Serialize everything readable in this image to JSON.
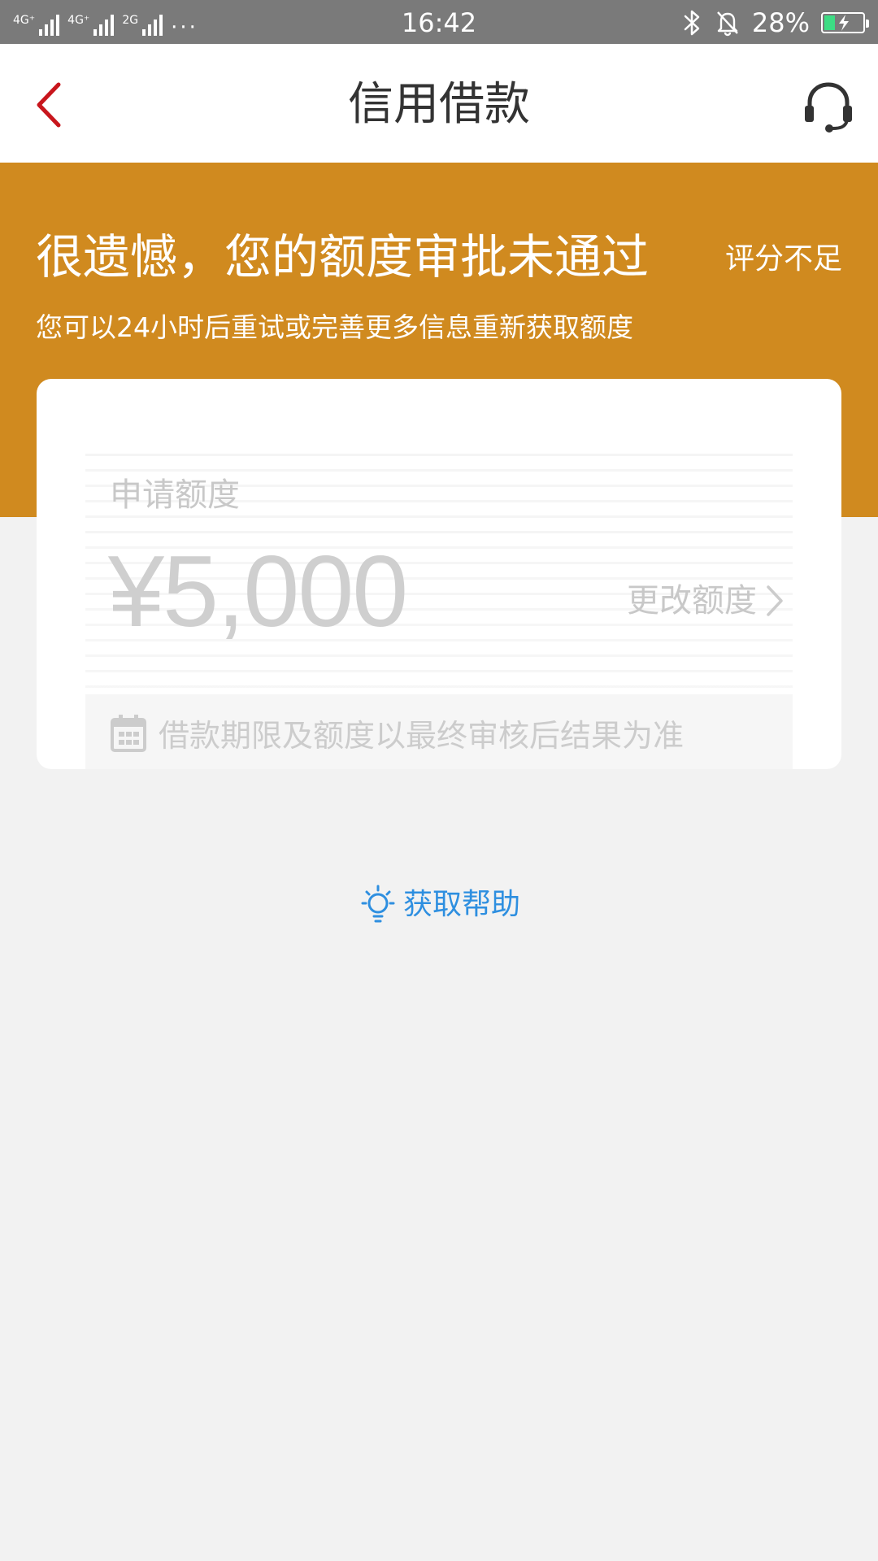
{
  "status_bar": {
    "network_1": "4G⁺",
    "network_2": "4G⁺",
    "network_3": "2G",
    "more": "···",
    "time": "16:42",
    "battery_percent": "28%",
    "battery_level": 0.28,
    "battery_color": "#3ddc84"
  },
  "nav": {
    "title": "信用借款",
    "back_icon": "chevron-left-icon",
    "service_icon": "headset-icon"
  },
  "banner": {
    "title": "很遗憾，您的额度审批未通过",
    "reason": "评分不足",
    "subtitle": "您可以24小时后重试或完善更多信息重新获取额度",
    "color": "#d08a1f"
  },
  "card": {
    "amount_label": "申请额度",
    "amount_value": "¥5,000",
    "change_amount_label": "更改额度",
    "note": "借款期限及额度以最终审核后结果为准"
  },
  "help": {
    "label": "获取帮助",
    "icon": "lightbulb-icon",
    "color": "#2e8fe0"
  }
}
